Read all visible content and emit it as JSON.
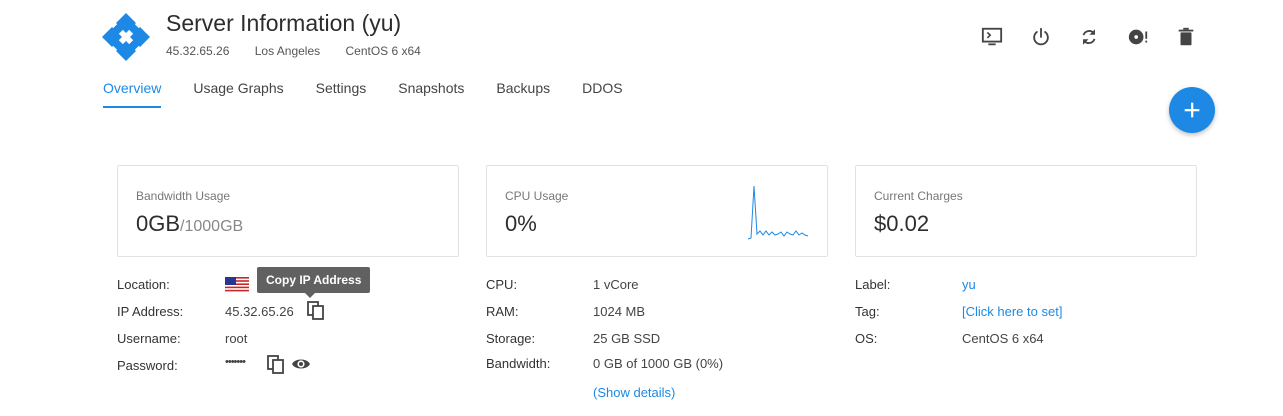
{
  "header": {
    "title": "Server Information (yu)",
    "ip": "45.32.65.26",
    "location": "Los Angeles",
    "os": "CentOS 6 x64"
  },
  "actions": [
    {
      "name": "console-icon"
    },
    {
      "name": "power-icon"
    },
    {
      "name": "restart-icon"
    },
    {
      "name": "reinstall-icon"
    },
    {
      "name": "trash-icon"
    }
  ],
  "tabs": [
    {
      "label": "Overview",
      "active": true
    },
    {
      "label": "Usage Graphs"
    },
    {
      "label": "Settings"
    },
    {
      "label": "Snapshots"
    },
    {
      "label": "Backups"
    },
    {
      "label": "DDOS"
    }
  ],
  "cards": {
    "bandwidth": {
      "label": "Bandwidth Usage",
      "value": "0GB",
      "sub": "/1000GB"
    },
    "cpu": {
      "label": "CPU Usage",
      "value": "0%"
    },
    "charges": {
      "label": "Current Charges",
      "value": "$0.02"
    }
  },
  "left_info": {
    "location_label": "Location:",
    "ip_label": "IP Address:",
    "ip_value": "45.32.65.26",
    "username_label": "Username:",
    "username_value": "root",
    "password_label": "Password:",
    "password_value": "•••••••",
    "tooltip": "Copy IP Address"
  },
  "mid_info": {
    "cpu_label": "CPU:",
    "cpu_value": "1 vCore",
    "ram_label": "RAM:",
    "ram_value": "1024 MB",
    "storage_label": "Storage:",
    "storage_value": "25 GB SSD",
    "bandwidth_label": "Bandwidth:",
    "bandwidth_value": "0 GB of 1000 GB (0%)",
    "show_details": "(Show details)"
  },
  "right_info": {
    "label_label": "Label:",
    "label_value": "yu",
    "tag_label": "Tag:",
    "tag_value": "[Click here to set]",
    "os_label": "OS:",
    "os_value": "CentOS 6 x64"
  },
  "colors": {
    "accent": "#1e88e5"
  }
}
